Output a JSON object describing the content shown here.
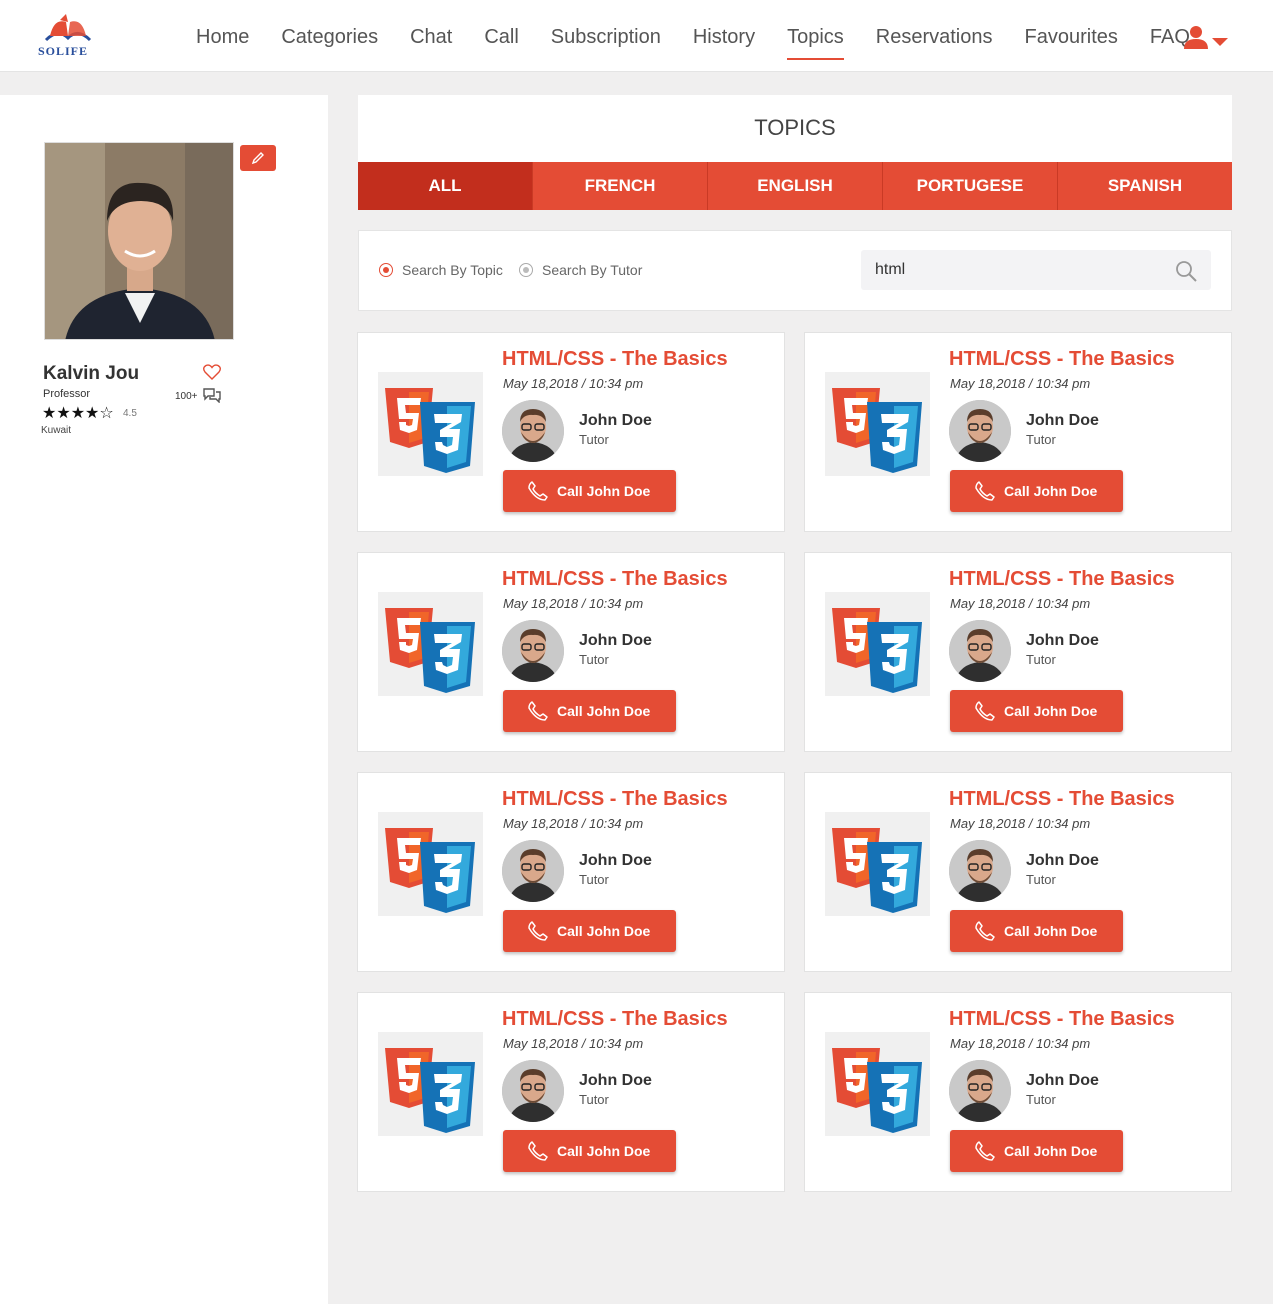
{
  "brand": {
    "logo_text": "SOLIFE",
    "accent": "#e44c35"
  },
  "nav": {
    "items": [
      "Home",
      "Categories",
      "Chat",
      "Call",
      "Subscription",
      "History",
      "Topics",
      "Reservations",
      "Favourites",
      "FAQ"
    ],
    "active": "Topics"
  },
  "profile": {
    "name": "Kalvin Jou",
    "role": "Professor",
    "stars": "★★★★☆",
    "rating": "4.5",
    "location": "Kuwait",
    "chat_count": "100+"
  },
  "topics": {
    "title": "TOPICS",
    "tabs": [
      "ALL",
      "FRENCH",
      "ENGLISH",
      "PORTUGESE",
      "SPANISH"
    ],
    "active_tab": "ALL"
  },
  "search": {
    "option_topic": "Search By Topic",
    "option_tutor": "Search By Tutor",
    "value": "html"
  },
  "cards": [
    {
      "title": "HTML/CSS - The Basics",
      "date": "May 18,2018 / 10:34 pm",
      "tutor": "John Doe",
      "tutor_role": "Tutor",
      "call_label": "Call John Doe"
    },
    {
      "title": "HTML/CSS - The Basics",
      "date": "May 18,2018 / 10:34 pm",
      "tutor": "John Doe",
      "tutor_role": "Tutor",
      "call_label": "Call John Doe"
    },
    {
      "title": "HTML/CSS - The Basics",
      "date": "May 18,2018 / 10:34 pm",
      "tutor": "John Doe",
      "tutor_role": "Tutor",
      "call_label": "Call John Doe"
    },
    {
      "title": "HTML/CSS - The Basics",
      "date": "May 18,2018 / 10:34 pm",
      "tutor": "John Doe",
      "tutor_role": "Tutor",
      "call_label": "Call John Doe"
    },
    {
      "title": "HTML/CSS - The Basics",
      "date": "May 18,2018 / 10:34 pm",
      "tutor": "John Doe",
      "tutor_role": "Tutor",
      "call_label": "Call John Doe"
    },
    {
      "title": "HTML/CSS - The Basics",
      "date": "May 18,2018 / 10:34 pm",
      "tutor": "John Doe",
      "tutor_role": "Tutor",
      "call_label": "Call John Doe"
    },
    {
      "title": "HTML/CSS - The Basics",
      "date": "May 18,2018 / 10:34 pm",
      "tutor": "John Doe",
      "tutor_role": "Tutor",
      "call_label": "Call John Doe"
    },
    {
      "title": "HTML/CSS - The Basics",
      "date": "May 18,2018 / 10:34 pm",
      "tutor": "John Doe",
      "tutor_role": "Tutor",
      "call_label": "Call John Doe"
    }
  ],
  "icons": {
    "logo": "book-logo-icon",
    "user": "user-icon",
    "edit": "pencil-icon",
    "favourite": "heart-icon",
    "chat": "chat-bubbles-icon",
    "search": "search-icon",
    "topic_thumb": "html5-css3-icon",
    "call": "phone-icon"
  }
}
